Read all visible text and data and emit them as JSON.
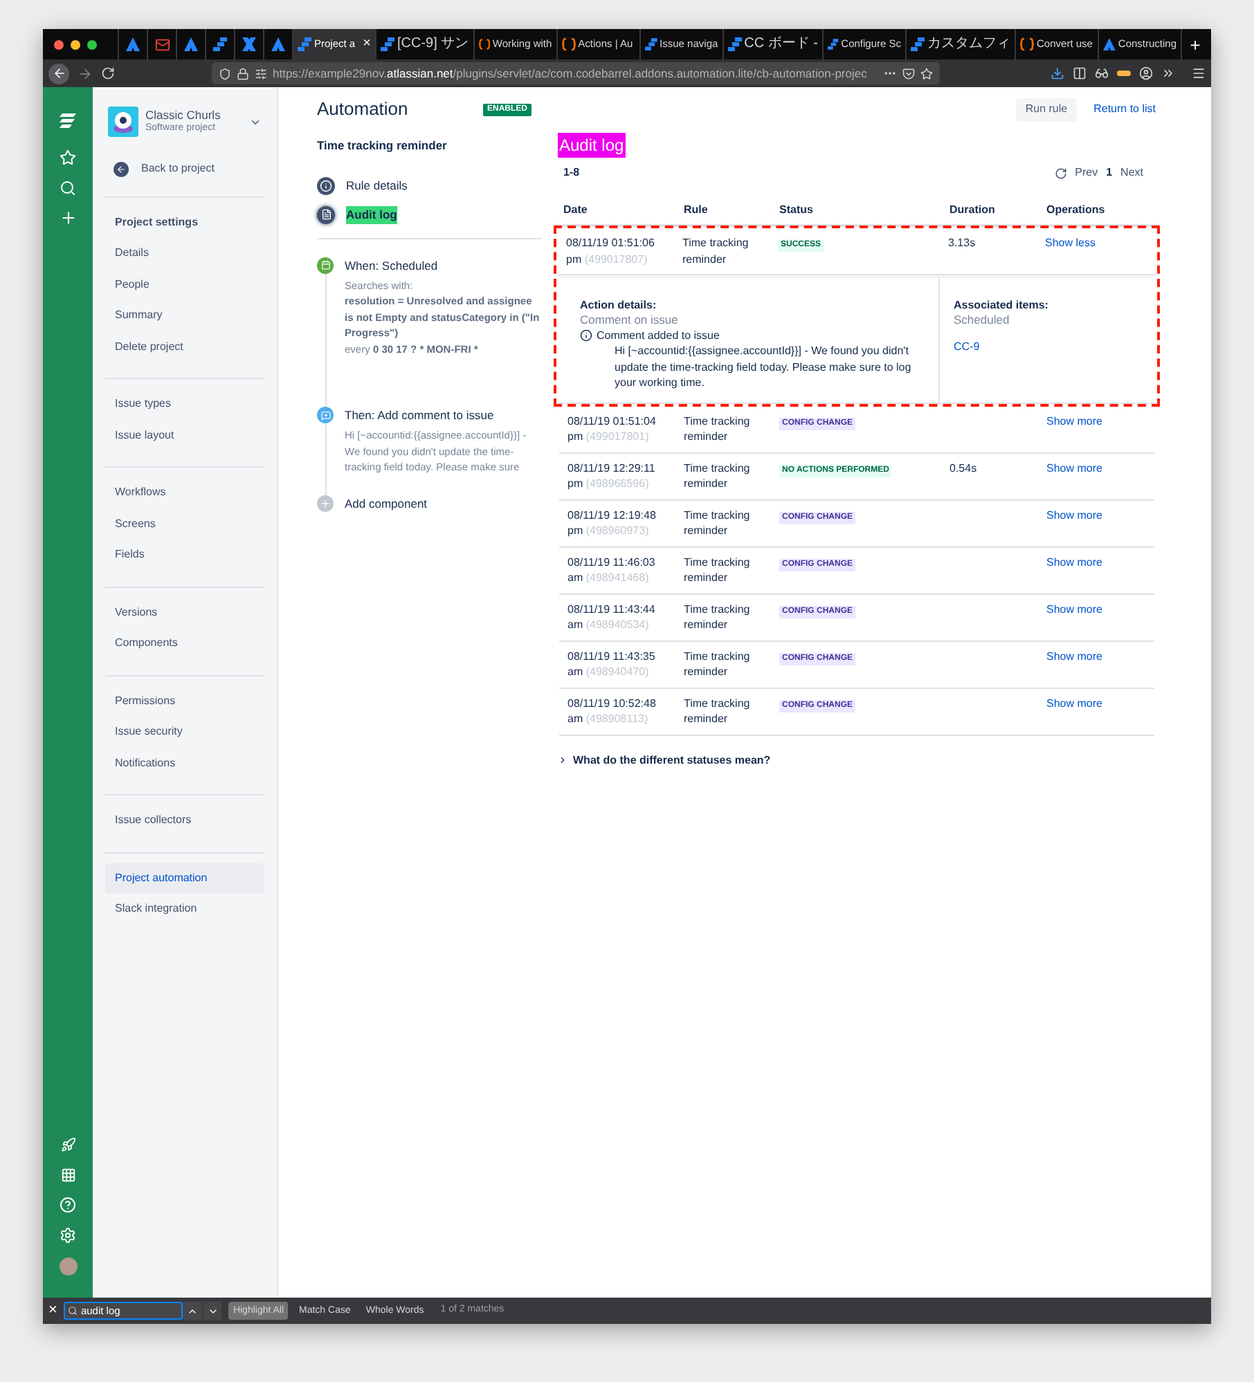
{
  "browser": {
    "tabs": [
      {
        "kind": "triangle",
        "selected": false
      },
      {
        "kind": "mail",
        "selected": false
      },
      {
        "kind": "triangle",
        "selected": false
      },
      {
        "kind": "stack",
        "selected": false
      },
      {
        "kind": "cross",
        "selected": false
      },
      {
        "kind": "triangle",
        "selected": false
      },
      {
        "kind": "stack",
        "title": "Project a",
        "selected": true,
        "close": "×"
      },
      {
        "kind": "stack",
        "title": "[CC-9] サン",
        "cjk": true,
        "selected": false
      },
      {
        "kind": "braces",
        "title": "Working with",
        "selected": false
      },
      {
        "kind": "braces",
        "title": "Actions | Au",
        "selected": false
      },
      {
        "kind": "stack",
        "title": "Issue naviga",
        "selected": false
      },
      {
        "kind": "stack",
        "title": "CC ボード -",
        "cjk": true,
        "selected": false
      },
      {
        "kind": "stack",
        "title": "Configure Sc",
        "selected": false
      },
      {
        "kind": "stack",
        "title": "カスタムフィ",
        "cjk": true,
        "selected": false
      },
      {
        "kind": "braces",
        "title": "Convert use",
        "selected": false
      },
      {
        "kind": "triangle",
        "title": "Constructing",
        "selected": false
      }
    ],
    "new_tab": "+",
    "url_prefix": "https://example29nov.",
    "url_domain": "atlassian.net",
    "url_path": "/plugins/servlet/ac/com.codebarrel.addons.automation.lite/cb-automation-projec"
  },
  "project": {
    "name": "Classic Churls",
    "type": "Software project"
  },
  "back_link": "Back to project",
  "sidebar": {
    "groups": [
      {
        "heading": "Project settings",
        "items": [
          {
            "label": "Details",
            "selected": false
          },
          {
            "label": "People",
            "selected": false
          },
          {
            "label": "Summary",
            "selected": false
          },
          {
            "label": "Delete project",
            "selected": false
          }
        ]
      },
      {
        "items": [
          {
            "label": "Issue types",
            "selected": false
          },
          {
            "label": "Issue layout",
            "selected": false
          }
        ]
      },
      {
        "items": [
          {
            "label": "Workflows",
            "selected": false
          },
          {
            "label": "Screens",
            "selected": false
          },
          {
            "label": "Fields",
            "selected": false
          }
        ]
      },
      {
        "items": [
          {
            "label": "Versions",
            "selected": false
          },
          {
            "label": "Components",
            "selected": false
          }
        ]
      },
      {
        "items": [
          {
            "label": "Permissions",
            "selected": false
          },
          {
            "label": "Issue security",
            "selected": false
          },
          {
            "label": "Notifications",
            "selected": false
          }
        ]
      },
      {
        "items": [
          {
            "label": "Issue collectors",
            "selected": false
          }
        ]
      },
      {
        "items": [
          {
            "label": "Project automation",
            "selected": true
          },
          {
            "label": "Slack integration",
            "selected": false
          }
        ]
      }
    ]
  },
  "header": {
    "title": "Automation",
    "badge": "ENABLED",
    "run_button": "Run rule",
    "return_link": "Return to list"
  },
  "rule": {
    "name": "Time tracking reminder",
    "nav": [
      {
        "kind": "info",
        "label": "Rule details",
        "highlighted": false,
        "current": false
      },
      {
        "kind": "log",
        "label": "Audit log",
        "highlighted": true,
        "current": true
      }
    ],
    "components": [
      {
        "kind": "trigger",
        "title": "When: Scheduled",
        "label": "Searches with:",
        "query": "resolution = Unresolved and assignee is not Empty and statusCategory in (\"In Progress\")",
        "schedule_prefix": "every",
        "schedule": "0 30 17 ? * MON-FRI *"
      },
      {
        "kind": "action",
        "title": "Then: Add comment to issue",
        "text": "Hi [~accountid:{{assignee.accountId}}] - We found you didn't update the time-tracking field today. Please make sure"
      },
      {
        "kind": "add",
        "title": "Add component"
      }
    ]
  },
  "audit": {
    "title": "Audit log",
    "highlighted": true,
    "current": false,
    "range": "1-8",
    "prev": "Prev",
    "page": "1",
    "next": "Next",
    "columns": [
      "Date",
      "Rule",
      "Status",
      "Duration",
      "Operations"
    ],
    "rows": [
      {
        "date": "08/11/19 01:51:06 pm",
        "id": "(499017807)",
        "rule": "Time tracking reminder",
        "status": {
          "label": "SUCCESS",
          "kind": "success"
        },
        "duration": "3.13s",
        "operation": "Show less",
        "expanded": true,
        "annotated": true,
        "details": {
          "action_label": "Action details:",
          "action": "Comment on issue",
          "message": "Comment added to issue",
          "comment": "Hi [~accountid:{{assignee.accountId}}] - We found you didn't update the time-tracking field today. Please make sure to log your working time.",
          "items_label": "Associated items:",
          "items_type": "Scheduled",
          "issue": "CC-9"
        }
      },
      {
        "date": "08/11/19 01:51:04 pm",
        "id": "(499017801)",
        "rule": "Time tracking reminder",
        "status": {
          "label": "CONFIG CHANGE",
          "kind": "config"
        },
        "operation": "Show more",
        "expanded": false,
        "annotated": false
      },
      {
        "date": "08/11/19 12:29:11 pm",
        "id": "(498966596)",
        "rule": "Time tracking reminder",
        "status": {
          "label": "NO ACTIONS PERFORMED",
          "kind": "success"
        },
        "duration": "0.54s",
        "operation": "Show more",
        "expanded": false,
        "annotated": false
      },
      {
        "date": "08/11/19 12:19:48 pm",
        "id": "(498960973)",
        "rule": "Time tracking reminder",
        "status": {
          "label": "CONFIG CHANGE",
          "kind": "config"
        },
        "operation": "Show more",
        "expanded": false,
        "annotated": false
      },
      {
        "date": "08/11/19 11:46:03 am",
        "id": "(498941468)",
        "rule": "Time tracking reminder",
        "status": {
          "label": "CONFIG CHANGE",
          "kind": "config"
        },
        "operation": "Show more",
        "expanded": false,
        "annotated": false
      },
      {
        "date": "08/11/19 11:43:44 am",
        "id": "(498940534)",
        "rule": "Time tracking reminder",
        "status": {
          "label": "CONFIG CHANGE",
          "kind": "config"
        },
        "operation": "Show more",
        "expanded": false,
        "annotated": false
      },
      {
        "date": "08/11/19 11:43:35 am",
        "id": "(498940470)",
        "rule": "Time tracking reminder",
        "status": {
          "label": "CONFIG CHANGE",
          "kind": "config"
        },
        "operation": "Show more",
        "expanded": false,
        "annotated": false
      },
      {
        "date": "08/11/19 10:52:48 am",
        "id": "(498908113)",
        "rule": "Time tracking reminder",
        "status": {
          "label": "CONFIG CHANGE",
          "kind": "config"
        },
        "operation": "Show more",
        "expanded": false,
        "annotated": false
      }
    ],
    "help": {
      "expanded": false,
      "label": "What do the different statuses mean?"
    }
  },
  "find_bar": {
    "close": "×",
    "value": "audit log",
    "options": [
      {
        "label": "Highlight All",
        "selected": true
      },
      {
        "label": "Match Case",
        "selected": false
      },
      {
        "label": "Whole Words",
        "selected": false
      }
    ],
    "result": "1 of 2 matches"
  }
}
